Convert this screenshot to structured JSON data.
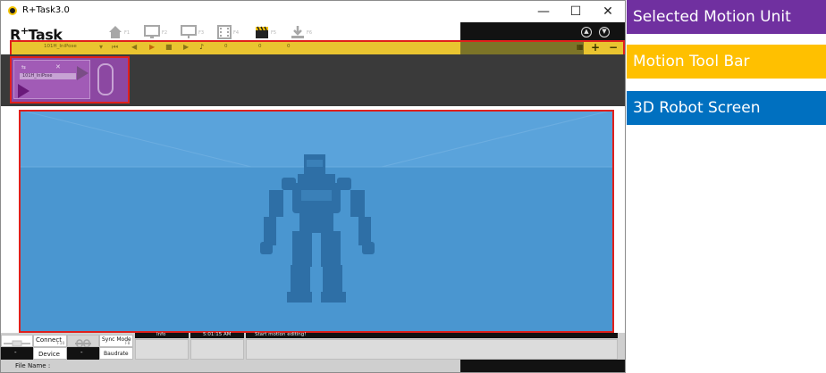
{
  "window": {
    "title": "R+Task3.0",
    "controls": {
      "minimize": "—",
      "maximize": "☐",
      "close": "✕"
    }
  },
  "header": {
    "logo_main": "R",
    "logo_plus": "+",
    "logo_rest": "Task",
    "nav": [
      {
        "icon": "home-icon",
        "label": "F1"
      },
      {
        "icon": "monitor-icon",
        "label": "F2"
      },
      {
        "icon": "display-icon",
        "label": "F3"
      },
      {
        "icon": "film-icon",
        "label": "F4"
      },
      {
        "icon": "clapper-icon",
        "label": "F5"
      },
      {
        "icon": "download-icon",
        "label": "F6"
      }
    ]
  },
  "motion_toolbar": {
    "motion_name": "101H_IniPose",
    "counter1": "0",
    "counter2": "0",
    "counter3": "0"
  },
  "motion_unit": {
    "label": "101H_IniPose"
  },
  "bottom_bar": {
    "connect_label": "Connect",
    "connect_shortcut": "F10",
    "device_label": "Device",
    "device_value": "-",
    "left_value": "-",
    "sync_mode_label": "Sync Mode",
    "sync_mode_shortcut": "F8",
    "baudrate_label": "Baudrate",
    "info_label": "Info",
    "time": "5:01:15 AM",
    "message": "Start motion editing!",
    "file_name_label": "File Name :"
  },
  "legend": [
    {
      "label": "Selected Motion Unit",
      "color": "#7030a0"
    },
    {
      "label": "Motion Tool Bar",
      "color": "#ffc000"
    },
    {
      "label": "3D Robot Screen",
      "color": "#0070c0"
    }
  ],
  "colors": {
    "highlight_border": "#e0201c",
    "robot_screen_bg": "#4a96d0",
    "toolbar_bg": "#e9c430",
    "unit_bg": "#8c48a2"
  }
}
